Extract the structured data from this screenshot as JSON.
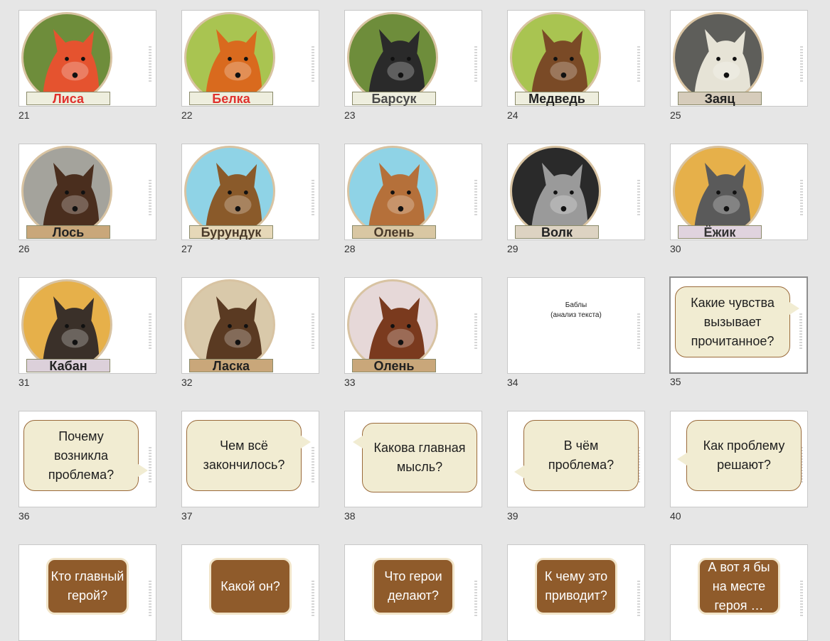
{
  "slides": [
    {
      "number": "21",
      "kind": "animal",
      "label": "Лиса",
      "label_color": "#e0322e",
      "label_bg": "#eeeede",
      "circle_bg": "#6e8d3b",
      "animal": "fox-icon",
      "animal_color": "#e5532f"
    },
    {
      "number": "22",
      "kind": "animal",
      "label": "Белка",
      "label_color": "#e0322e",
      "label_bg": "#eeeede",
      "circle_bg": "#a9c451",
      "animal": "squirrel-icon",
      "animal_color": "#d96a1e"
    },
    {
      "number": "23",
      "kind": "animal",
      "label": "Барсук",
      "label_color": "#4a4a4a",
      "label_bg": "#eeeede",
      "circle_bg": "#6e8d3b",
      "animal": "badger-icon",
      "animal_color": "#2a2a2a"
    },
    {
      "number": "24",
      "kind": "animal",
      "label": "Медведь",
      "label_color": "#222222",
      "label_bg": "#eeeede",
      "circle_bg": "#a9c451",
      "animal": "bear-icon",
      "animal_color": "#7a4a26"
    },
    {
      "number": "25",
      "kind": "animal",
      "label": "Заяц",
      "label_color": "#222222",
      "label_bg": "#d6ccbb",
      "circle_bg": "#5e5e5a",
      "animal": "hare-icon",
      "animal_color": "#e6e3d6"
    },
    {
      "number": "26",
      "kind": "animal",
      "label": "Лось",
      "label_color": "#222222",
      "label_bg": "#c9a77a",
      "circle_bg": "#a4a39c",
      "animal": "moose-icon",
      "animal_color": "#4a2e1e"
    },
    {
      "number": "27",
      "kind": "animal",
      "label": "Бурундук",
      "label_color": "#4a3a2a",
      "label_bg": "#e6d8b8",
      "circle_bg": "#8fd3e6",
      "animal": "chipmunk-icon",
      "animal_color": "#8a5a2a"
    },
    {
      "number": "28",
      "kind": "animal",
      "label": "Олень",
      "label_color": "#4a3a2a",
      "label_bg": "#d9c7a3",
      "circle_bg": "#8fd3e6",
      "animal": "deer-fawn-icon",
      "animal_color": "#b5703a"
    },
    {
      "number": "29",
      "kind": "animal",
      "label": "Волк",
      "label_color": "#222222",
      "label_bg": "#ddd3c2",
      "circle_bg": "#2a2a2a",
      "animal": "wolf-icon",
      "animal_color": "#9a9a9a"
    },
    {
      "number": "30",
      "kind": "animal",
      "label": "Ёжик",
      "label_color": "#333333",
      "label_bg": "#e0d3de",
      "circle_bg": "#e6b04a",
      "animal": "hedgehog-icon",
      "animal_color": "#5a5a5a"
    },
    {
      "number": "31",
      "kind": "animal",
      "label": "Кабан",
      "label_color": "#222222",
      "label_bg": "#dcd0da",
      "circle_bg": "#e6b04a",
      "animal": "boar-icon",
      "animal_color": "#3a3029"
    },
    {
      "number": "32",
      "kind": "animal",
      "label": "Ласка",
      "label_color": "#222222",
      "label_bg": "#c9a77a",
      "circle_bg": "#d9c9aa",
      "animal": "marten-icon",
      "animal_color": "#5a3a22"
    },
    {
      "number": "33",
      "kind": "animal",
      "label": "Олень",
      "label_color": "#222222",
      "label_bg": "#c9a77a",
      "circle_bg": "#e6d8d8",
      "animal": "stag-icon",
      "animal_color": "#7a3a1e"
    },
    {
      "number": "34",
      "kind": "text",
      "lines": [
        "Баблы",
        "(анализ текста)"
      ]
    },
    {
      "number": "35",
      "kind": "bubble",
      "text": "Какие чувства вызывает прочитанное?",
      "tail": "right",
      "selected": true
    },
    {
      "number": "36",
      "kind": "bubble",
      "text": "Почему возникла проблема?",
      "tail": "right-bottom"
    },
    {
      "number": "37",
      "kind": "bubble",
      "text": "Чем всё закончилось?",
      "tail": "right"
    },
    {
      "number": "38",
      "kind": "bubble",
      "text": "Какова главная мысль?",
      "tail": "left-top"
    },
    {
      "number": "39",
      "kind": "bubble",
      "text": "В чём проблема?",
      "tail": "left-bottom"
    },
    {
      "number": "40",
      "kind": "bubble",
      "text": "Как проблему решают?",
      "tail": "left"
    },
    {
      "number": "",
      "kind": "brown",
      "text": "Кто главный герой?"
    },
    {
      "number": "",
      "kind": "brown",
      "text": "Какой он?"
    },
    {
      "number": "",
      "kind": "brown",
      "text": "Что герои делают?"
    },
    {
      "number": "",
      "kind": "brown",
      "text": "К чему это приводит?"
    },
    {
      "number": "",
      "kind": "brown",
      "text": "А вот я бы на месте героя …"
    }
  ]
}
